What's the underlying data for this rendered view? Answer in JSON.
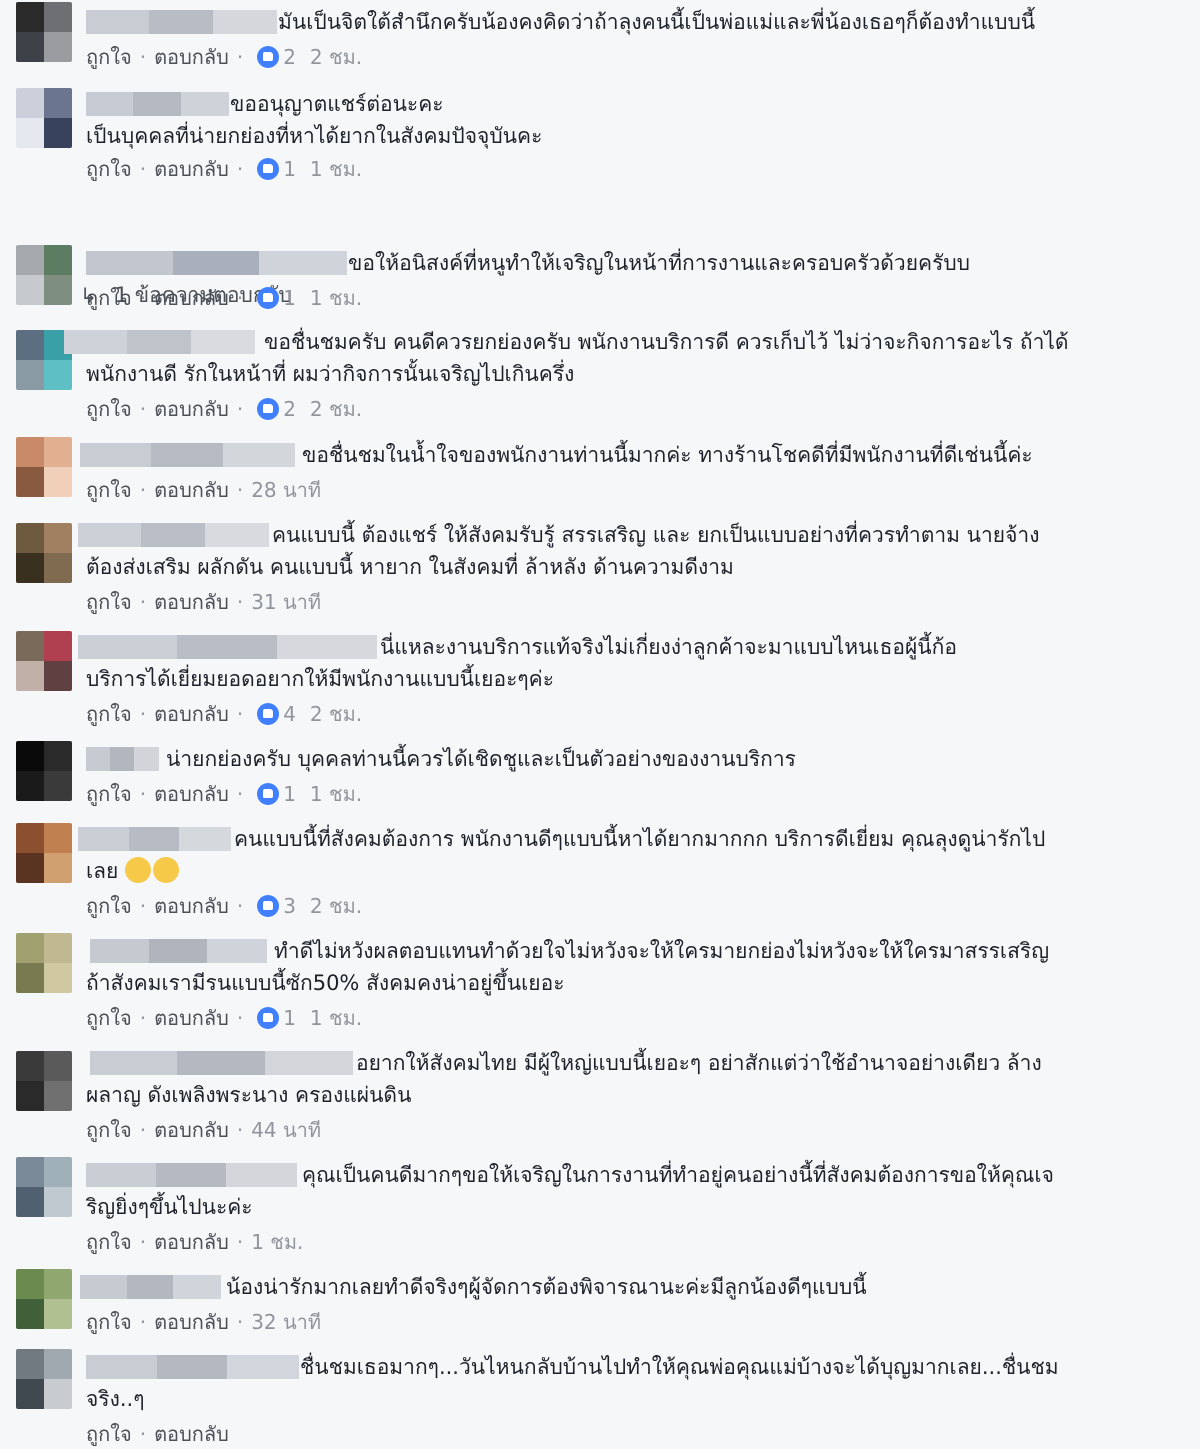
{
  "labels": {
    "like": "ถูกใจ",
    "reply": "ตอบกลับ",
    "separator": "·"
  },
  "colors": {
    "like_badge": "#4080ff",
    "meta_text": "#90949c",
    "body_text": "#1d2129"
  },
  "comments": [
    {
      "lines": [
        "มันเป็นจิตใต้สำนึกครับน้องคงคิดว่าถ้าลุงคนนี้เป็นพ่อแม่และพี่น้องเธอๆก็ต้องทำแบบนี้"
      ],
      "likes": "2",
      "time": "2 ชม."
    },
    {
      "lines": [
        "ขออนุญาตแชร์ต่อนะคะ",
        "เป็นบุคคลที่น่ายกย่องที่หาได้ยากในสังคมปัจจุบันคะ"
      ],
      "likes": "1",
      "time": "1 ชม.",
      "replies": "1 ข้อความตอบกลับ"
    },
    {
      "lines": [
        "ขอให้อนิสงค์ที่หนูทำให้เจริญในหน้าที่การงานและครอบครัวด้วยครับบ"
      ],
      "likes": "1",
      "time": "1 ชม."
    },
    {
      "lines": [
        "ขอชื่นชมครับ คนดีควรยกย่องครับ พนักงานบริการดี ควรเก็บไว้ ไม่ว่าจะกิจการอะไร ถ้าได้",
        "พนักงานดี รักในหน้าที่ ผมว่ากิจการนั้นเจริญไปเกินครึ่ง"
      ],
      "likes": "2",
      "time": "2 ชม."
    },
    {
      "lines": [
        "ขอชื่นชมในน้ำใจของพนักงานท่านนี้มากค่ะ ทางร้านโชคดีที่มีพนักงานที่ดีเช่นนี้ค่ะ"
      ],
      "likes": "",
      "time": "28 นาที"
    },
    {
      "lines": [
        "คนแบบนี้ ต้องแชร์ ให้สังคมรับรู้ สรรเสริญ และ ยกเป็นแบบอย่างที่ควรทำตาม นายจ้าง",
        "ต้องส่งเสริม ผลักดัน คนแบบนี้ หายาก ในสังคมที่ ล้าหลัง ด้านความดีงาม"
      ],
      "likes": "",
      "time": "31 นาที"
    },
    {
      "lines": [
        "นี่แหละงานบริการแท้จริงไม่เกี่ยงง่าลูกค้าจะมาแบบไหนเธอผู้นี้ก้อ",
        "บริการได้เยี่ยมยอดอยากให้มีพนักงานแบบนี้เยอะๆค่ะ"
      ],
      "likes": "4",
      "time": "2 ชม."
    },
    {
      "lines": [
        "น่ายกย่องครับ บุคคลท่านนี้ควรได้เชิดชูและเป็นตัวอย่างของงานบริการ"
      ],
      "likes": "1",
      "time": "1 ชม."
    },
    {
      "lines": [
        "คนแบบนี้ที่สังคมต้องการ พนักงานดีๆแบบนี้หาได้ยากมากกก บริการดีเยี่ยม คุณลุงดูน่ารักไป",
        "เลย"
      ],
      "likes": "3",
      "time": "2 ชม.",
      "emoji": "laughing-crying-emoji"
    },
    {
      "lines": [
        "ทำดีไม่หวังผลตอบแทนทำด้วยใจไม่หวังจะให้ใครมายกย่องไม่หวังจะให้ใครมาสรรเสริญ",
        "ถ้าสังคมเรามีรนแบบนี้ซัก50% สังคมคงน่าอยู่ขึ้นเยอะ"
      ],
      "likes": "1",
      "time": "1 ชม."
    },
    {
      "lines": [
        "อยากให้สังคมไทย มีผู้ใหญ่แบบนี้เยอะๆ อย่าสักแต่ว่าใช้อำนาจอย่างเดียว ล้าง",
        "ผลาญ ดังเพลิงพระนาง ครองแผ่นดิน"
      ],
      "likes": "",
      "time": "44 นาที"
    },
    {
      "lines": [
        "คุณเป็นคนดีมากๆขอให้เจริญในการงานที่ทำอยู่คนอย่างนี้ที่สังคมต้องการขอให้คุณเจ",
        "ริญยิ่งๆขึ้นไปนะค่ะ"
      ],
      "likes": "",
      "time": "1 ชม."
    },
    {
      "lines": [
        "น้องน่ารักมากเลยทำดีจริงๆผู้จัดการต้องพิจารณานะค่ะมีลูกน้องดีๆแบบนี้"
      ],
      "likes": "",
      "time": "32 นาที"
    },
    {
      "lines": [
        "ชื่นชมเธอมากๆ...วันไหนกลับบ้านไปทำให้คุณพ่อคุณแม่บ้างจะได้บุญมากเลย...ชื่นชม",
        "จริง..ๆ"
      ],
      "likes": "",
      "time": ""
    }
  ]
}
